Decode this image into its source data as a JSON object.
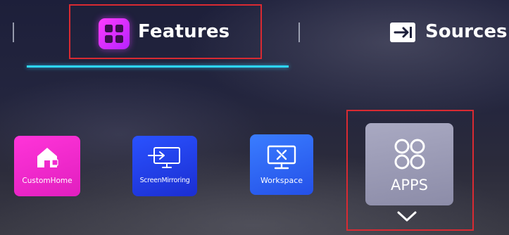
{
  "tabs": {
    "features": {
      "label": "Features",
      "icon": "features-grid-icon",
      "accent": "#e02cff"
    },
    "sources": {
      "label": "Sources",
      "icon": "source-input-icon"
    },
    "active_underline_color": "#2ed6ff"
  },
  "tiles": [
    {
      "label": "CustomHome",
      "icon": "home-icon",
      "color": "#f22ad0"
    },
    {
      "label": "ScreenMirroring",
      "icon": "screen-mirroring-icon",
      "color": "#2440f0"
    },
    {
      "label": "Workspace",
      "icon": "workspace-monitor-icon",
      "color": "#2f66f5"
    },
    {
      "label": "APPS",
      "icon": "apps-circles-icon",
      "color": "#9c9cb6",
      "focused": true
    }
  ],
  "highlight_color": "#d92a32"
}
